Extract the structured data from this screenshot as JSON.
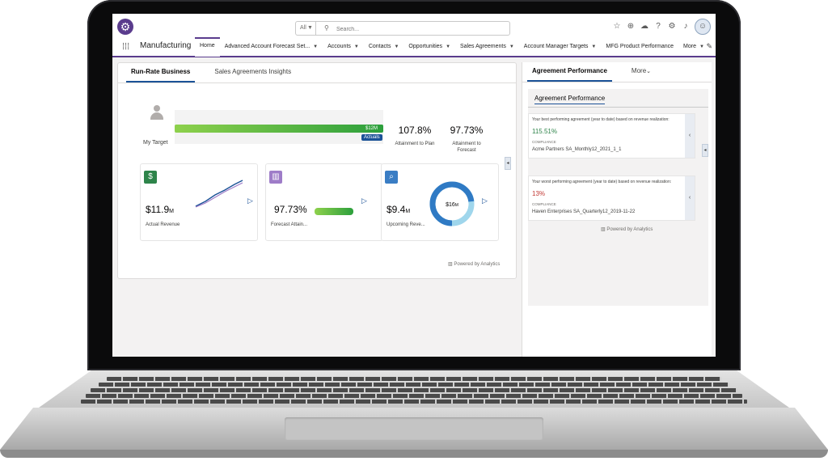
{
  "header": {
    "scope_label": "All",
    "search_placeholder": "Search..."
  },
  "nav": {
    "app_name": "Manufacturing",
    "items": [
      {
        "label": "Home"
      },
      {
        "label": "Advanced Account Forecast Set..."
      },
      {
        "label": "Accounts"
      },
      {
        "label": "Contacts"
      },
      {
        "label": "Opportunities"
      },
      {
        "label": "Sales Agreements"
      },
      {
        "label": "Account Manager Targets"
      },
      {
        "label": "MFG Product Performance"
      },
      {
        "label": "More"
      }
    ]
  },
  "main": {
    "tabs": [
      {
        "label": "Run-Rate Business"
      },
      {
        "label": "Sales Agreements Insights"
      }
    ],
    "target_label": "My Target",
    "progress_value_label": "$12M",
    "actuals_label": "Actuals",
    "progress_fraction": 1.0,
    "attainment_plan_value": "107.8%",
    "attainment_plan_label": "Attainment to Plan",
    "attainment_forecast_value": "97.73%",
    "attainment_forecast_label": "Attainment to Forecast",
    "tiles": [
      {
        "icon": "money-bag-icon",
        "value": "$11.9",
        "unit": "M",
        "label": "Actual Revenue"
      },
      {
        "icon": "bar-chart-icon",
        "value": "97.73%",
        "unit": "",
        "label": "Forecast Attain..."
      },
      {
        "icon": "clipboard-search-icon",
        "value": "$9.4",
        "unit": "M",
        "label": "Upcoming Reve...",
        "donut_value": "$16",
        "donut_unit": "M"
      }
    ],
    "powered_by": "Powered by Analytics"
  },
  "side": {
    "tabs": [
      {
        "label": "Agreement Performance"
      },
      {
        "label": "More"
      }
    ],
    "section_title": "Agreement Performance",
    "cards": [
      {
        "description": "Your best performing agreement (year to date) based on revenue realization:",
        "value": "115.51%",
        "tag": "COMPLIANCE",
        "name": "Acme Partners SA_Monthly12_2021_1_1"
      },
      {
        "description": "Your worst performing agreement (year to date) based on revenue realization:",
        "value": "13%",
        "tag": "COMPLIANCE",
        "name": "Haven Enterprises SA_Quarterly12_2019-11-22"
      }
    ],
    "powered_by": "Powered by Analytics"
  },
  "colors": {
    "brand": "#5a3c8d",
    "accent_blue": "#1b5297",
    "green": "#2e844a",
    "red": "#c23934",
    "tile_money": "#2e844a",
    "tile_chart": "#9e7cc8",
    "tile_clip": "#3a7dc4"
  }
}
